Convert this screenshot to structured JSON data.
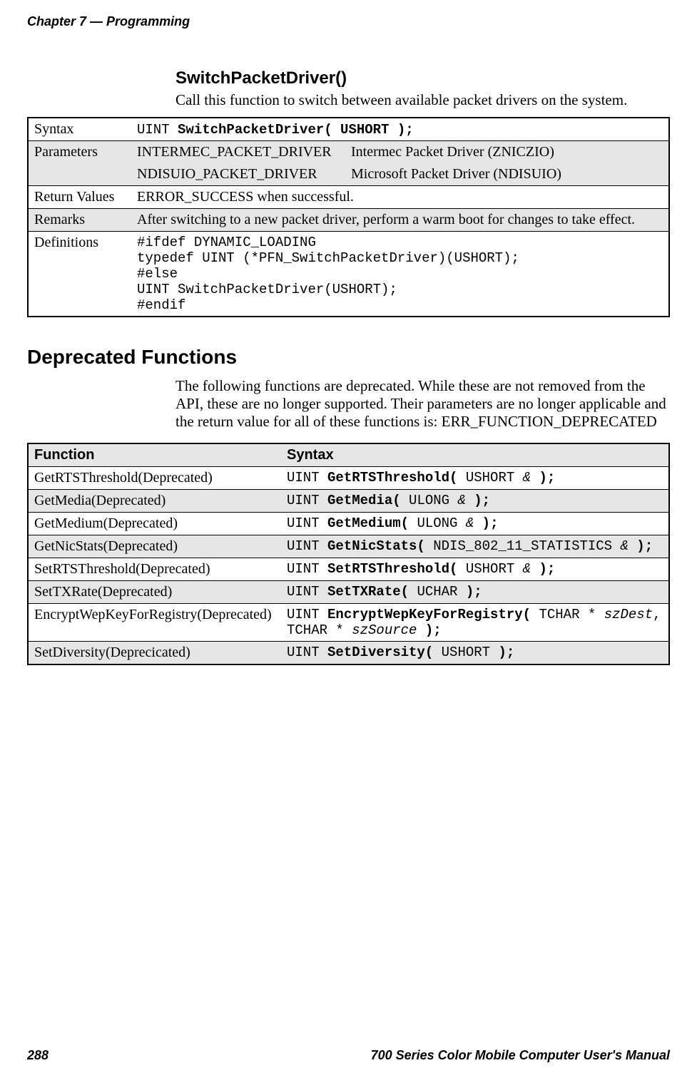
{
  "header": {
    "chapter": "Chapter 7",
    "sep": " — ",
    "title": "Programming"
  },
  "function": {
    "name": "SwitchPacketDriver()",
    "intro": "Call this function to switch between available packet drivers on the system.",
    "rows": {
      "syntax_label": "Syntax",
      "syntax_prefix": "UINT ",
      "syntax_bold": "SwitchPacketDriver( USHORT );",
      "params_label": "Parameters",
      "param1_key": "INTERMEC_PACKET_DRIVER",
      "param1_val": "Intermec Packet Driver (ZNICZIO)",
      "param2_key": "NDISUIO_PACKET_DRIVER",
      "param2_val": "Microsoft Packet Driver (NDISUIO)",
      "return_label": "Return Values",
      "return_val": "ERROR_SUCCESS when successful.",
      "remarks_label": "Remarks",
      "remarks_val": "After switching to a new packet driver, perform a warm boot for changes to take effect.",
      "defs_label": "Definitions",
      "defs_l1": "#ifdef DYNAMIC_LOADING",
      "defs_l2": "typedef UINT (*PFN_SwitchPacketDriver)(USHORT);",
      "defs_l3": "#else",
      "defs_l4": "UINT SwitchPacketDriver(USHORT);",
      "defs_l5": "#endif"
    }
  },
  "deprecated": {
    "heading": "Deprecated Functions",
    "intro": "The following functions are deprecated. While these are not removed from the API, these are no longer supported. Their parameters are no longer applicable and the return value for all of these functions is: ERR_FUNCTION_DEPRECATED",
    "th_function": "Function",
    "th_syntax": "Syntax",
    "rows": [
      {
        "fn": "GetRTSThreshold(Deprecated)",
        "pre": "UINT ",
        "bold": "GetRTSThreshold(",
        "mid": " USHORT ",
        "amp": "&",
        "post": " );"
      },
      {
        "fn": "GetMedia(Deprecated)",
        "pre": "UINT ",
        "bold": "GetMedia(",
        "mid": " ULONG ",
        "amp": "&",
        "post": " );"
      },
      {
        "fn": "GetMedium(Deprecated)",
        "pre": "UINT ",
        "bold": "GetMedium(",
        "mid": " ULONG ",
        "amp": "&",
        "post": " );"
      },
      {
        "fn": "GetNicStats(Deprecated)",
        "pre": "UINT ",
        "bold": "GetNicStats(",
        "mid": " NDIS_802_11_STATISTICS ",
        "amp": "&",
        "post": " );"
      },
      {
        "fn": "SetRTSThreshold(Deprecated)",
        "pre": "UINT ",
        "bold": "SetRTSThreshold(",
        "mid": " USHORT ",
        "amp": "&",
        "post": " );"
      },
      {
        "fn": "SetTXRate(Deprecated)",
        "pre": "UINT ",
        "bold": "SetTXRate(",
        "mid": " UCHAR ",
        "amp": "",
        "post": ");"
      },
      {
        "fn": "EncryptWepKeyForRegistry(Deprecated)",
        "pre": "UINT ",
        "bold": "EncryptWepKeyForRegistry(",
        "mid": " TCHAR * ",
        "amp": "",
        "post": "",
        "ital1": "szDest",
        "mid2": ", TCHAR * ",
        "ital2": "szSource",
        "post2": " );"
      },
      {
        "fn": "SetDiversity(Deprecicated)",
        "pre": "UINT ",
        "bold": "SetDiversity(",
        "mid": " USHORT ",
        "amp": "",
        "post": ");"
      }
    ]
  },
  "footer": {
    "page": "288",
    "title": "700 Series Color Mobile Computer User's Manual"
  }
}
